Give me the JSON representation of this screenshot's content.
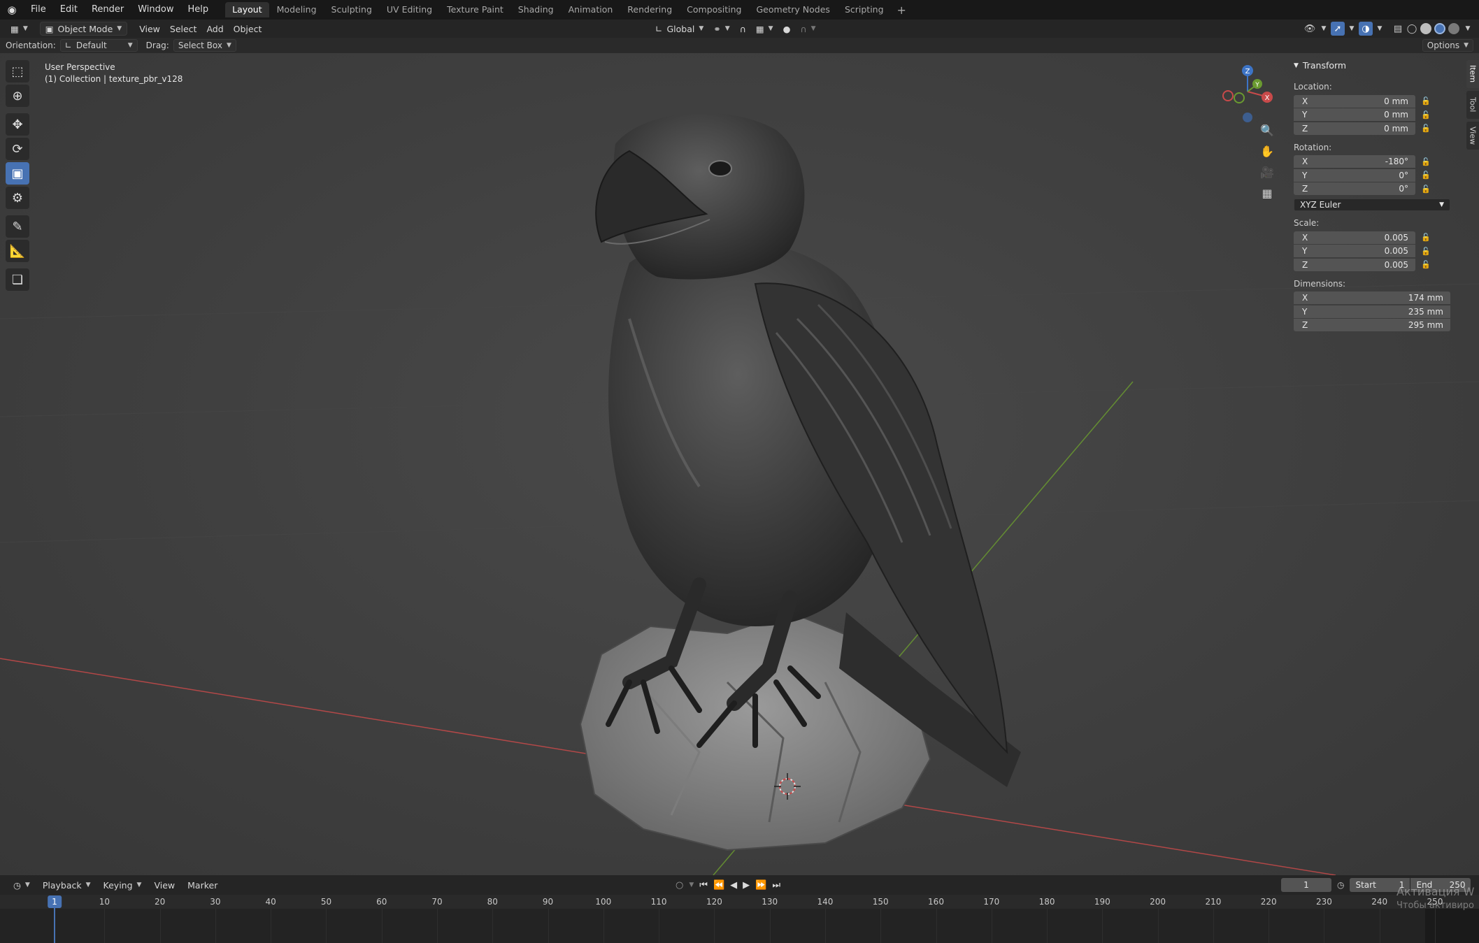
{
  "menubar": {
    "items": [
      "File",
      "Edit",
      "Render",
      "Window",
      "Help"
    ],
    "workspaces": [
      "Layout",
      "Modeling",
      "Sculpting",
      "UV Editing",
      "Texture Paint",
      "Shading",
      "Animation",
      "Rendering",
      "Compositing",
      "Geometry Nodes",
      "Scripting"
    ],
    "active_workspace": "Layout",
    "add_tab": "+"
  },
  "viewport_header": {
    "mode": "Object Mode",
    "menus": [
      "View",
      "Select",
      "Add",
      "Object"
    ],
    "transform_orientation": "Global"
  },
  "tool_settings": {
    "orientation_label": "Orientation:",
    "orientation_value": "Default",
    "drag_label": "Drag:",
    "drag_value": "Select Box",
    "options": "Options"
  },
  "viewport": {
    "view_name": "User Perspective",
    "collection_info": "(1) Collection | texture_pbr_v128",
    "gizmo": {
      "z": "Z",
      "y": "Y",
      "x": "X"
    }
  },
  "npanel": {
    "title": "Transform",
    "location_label": "Location:",
    "location": [
      {
        "axis": "X",
        "value": "0 mm"
      },
      {
        "axis": "Y",
        "value": "0 mm"
      },
      {
        "axis": "Z",
        "value": "0 mm"
      }
    ],
    "rotation_label": "Rotation:",
    "rotation": [
      {
        "axis": "X",
        "value": "-180°"
      },
      {
        "axis": "Y",
        "value": "0°"
      },
      {
        "axis": "Z",
        "value": "0°"
      }
    ],
    "rotation_mode": "XYZ Euler",
    "scale_label": "Scale:",
    "scale": [
      {
        "axis": "X",
        "value": "0.005"
      },
      {
        "axis": "Y",
        "value": "0.005"
      },
      {
        "axis": "Z",
        "value": "0.005"
      }
    ],
    "dimensions_label": "Dimensions:",
    "dimensions": [
      {
        "axis": "X",
        "value": "174 mm"
      },
      {
        "axis": "Y",
        "value": "235 mm"
      },
      {
        "axis": "Z",
        "value": "295 mm"
      }
    ],
    "tabs": [
      "Item",
      "Tool",
      "View"
    ]
  },
  "timeline": {
    "menus": [
      "Playback",
      "Keying",
      "View",
      "Marker"
    ],
    "current_frame": "1",
    "start_label": "Start",
    "start_value": "1",
    "end_label": "End",
    "end_value": "250",
    "ruler": [
      "10",
      "20",
      "30",
      "40",
      "50",
      "60",
      "70",
      "80",
      "90",
      "100",
      "110",
      "120",
      "130",
      "140",
      "150",
      "160",
      "170",
      "180",
      "190",
      "200",
      "210",
      "220",
      "230",
      "240",
      "250"
    ]
  },
  "watermark": {
    "line1": "Активация W",
    "line2": "Чтобы активиро"
  },
  "colors": {
    "accent": "#4772b3",
    "x_axis": "#c84a4a",
    "y_axis": "#6a9a30",
    "z_axis": "#3d74c6"
  }
}
